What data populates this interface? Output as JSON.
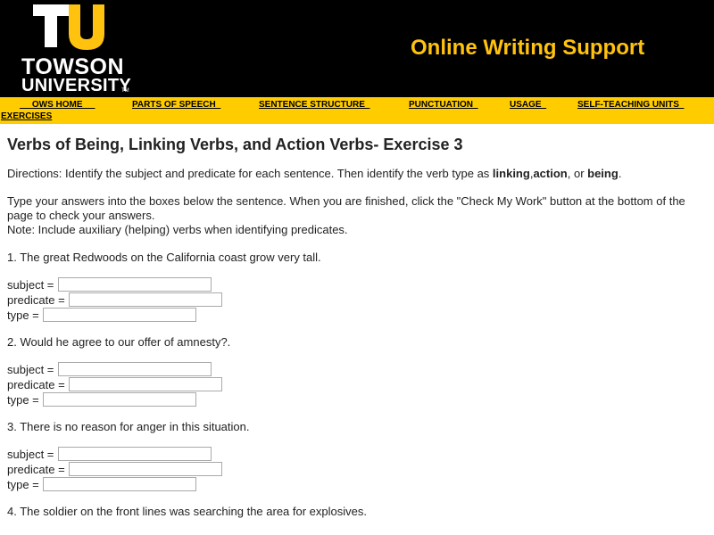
{
  "header": {
    "logo_line1": "TOWSON",
    "logo_line2": "UNIVERSITY",
    "logo_tm": "TM",
    "site_title": "Online Writing Support",
    "colors": {
      "gold": "#ffc20e",
      "black": "#000000",
      "nav_bg": "#ffcc00"
    }
  },
  "nav": {
    "items": [
      {
        "label": "     OWS HOME     "
      },
      {
        "label": "PARTS OF SPEECH  "
      },
      {
        "label": "SENTENCE STRUCTURE  "
      },
      {
        "label": "PUNCTUATION  "
      },
      {
        "label": "USAGE  "
      },
      {
        "label": "SELF-TEACHING UNITS  "
      },
      {
        "label": "EXERCISES"
      }
    ]
  },
  "main": {
    "title": "Verbs of Being, Linking Verbs, and Action Verbs- Exercise 3",
    "directions_prefix": "Directions:  Identify the subject and predicate for each sentence.  Then identify the verb type as ",
    "directions_linking": "linking",
    "directions_comma": ",",
    "directions_action": "action",
    "directions_or": ", or ",
    "directions_being": "being",
    "directions_end": ".",
    "instructions": "Type your answers into the boxes below the sentence. When you are finished, click  the \"Check My Work\" button at the bottom of the page to check your answers.",
    "note": "Note:  Include auxiliary (helping) verbs when identifying predicates.",
    "field_labels": {
      "subject": "subject = ",
      "predicate": "predicate = ",
      "type": "type = "
    },
    "questions": [
      {
        "text": "1.  The great Redwoods on the California coast grow very tall."
      },
      {
        "text": "2.  Would he agree to our offer of amnesty?."
      },
      {
        "text": "3.  There is no reason for anger in this situation."
      },
      {
        "text": "4.  The soldier on the front lines was searching the area for explosives."
      }
    ]
  }
}
